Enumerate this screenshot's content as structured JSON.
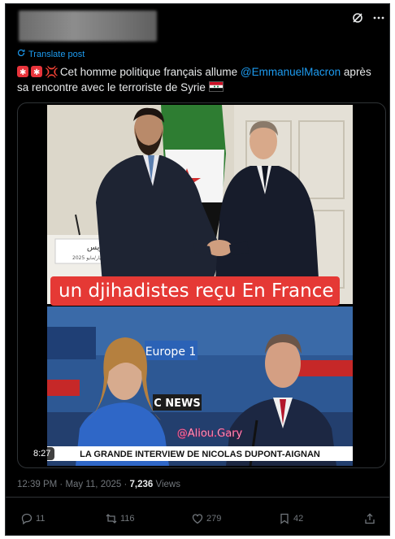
{
  "header": {
    "grok_icon": "grok-icon",
    "more_icon": "more-icon"
  },
  "post": {
    "translate_label": "Translate post",
    "text_before": "Cet homme politique français allume ",
    "mention": "@EmmanuelMacron",
    "text_after": " après sa rencontre avec le terroriste de Syrie"
  },
  "media": {
    "caption": "un djihadistes reçu En France",
    "podium_text_1": "باريس",
    "podium_text_2": "الأربعاء 7 أيار/مايو 2025",
    "channel_logo": "Europe 1",
    "news_label": "C NEWS",
    "watermark": "@Aliou.Gary",
    "lower_third": "LA GRANDE INTERVIEW DE NICOLAS DUPONT-AIGNAN",
    "duration": "8:27"
  },
  "meta": {
    "timestamp": "12:39 PM · May 11, 2025 · ",
    "views_count": "7,236",
    "views_label": " Views"
  },
  "actions": {
    "replies": "11",
    "reposts": "116",
    "likes": "279",
    "bookmarks": "42"
  },
  "colors": {
    "accent": "#1d9bf0",
    "caption_red": "#e53935",
    "background": "#000000"
  }
}
